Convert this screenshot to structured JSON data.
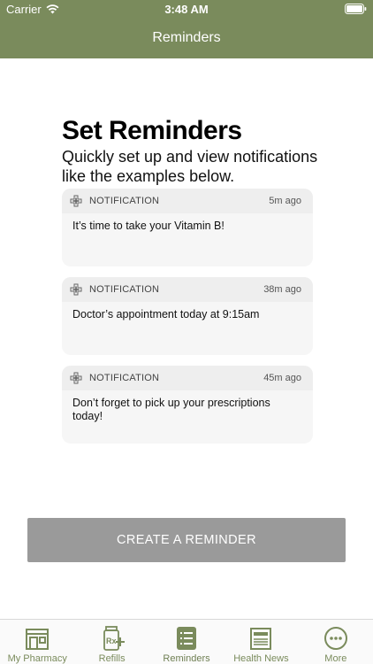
{
  "status_bar": {
    "carrier": "Carrier",
    "time": "3:48 AM"
  },
  "nav": {
    "title": "Reminders"
  },
  "intro": {
    "title": "Set Reminders",
    "subtitle": "Quickly set up and view notifications like the examples below."
  },
  "notifications": [
    {
      "kind": "NOTIFICATION",
      "time": "5m ago",
      "message": "It’s time to take your Vitamin B!"
    },
    {
      "kind": "NOTIFICATION",
      "time": "38m ago",
      "message": "Doctor’s appointment today at 9:15am"
    },
    {
      "kind": "NOTIFICATION",
      "time": "45m ago",
      "message": "Don’t forget to pick up your prescriptions today!"
    }
  ],
  "create_button": {
    "label": "CREATE A REMINDER"
  },
  "tab_bar": {
    "tabs": [
      {
        "label": "My Pharmacy",
        "icon": "storefront-icon"
      },
      {
        "label": "Refills",
        "icon": "rx-plus-icon"
      },
      {
        "label": "Reminders",
        "icon": "checklist-icon",
        "active": true
      },
      {
        "label": "Health News",
        "icon": "newspaper-icon"
      },
      {
        "label": "More",
        "icon": "more-dots-icon"
      }
    ]
  },
  "colors": {
    "brand": "#7a8b5c",
    "button_disabled": "#9a9a9a",
    "card_bg": "#f6f6f6",
    "card_head_bg": "#eeeeee"
  }
}
